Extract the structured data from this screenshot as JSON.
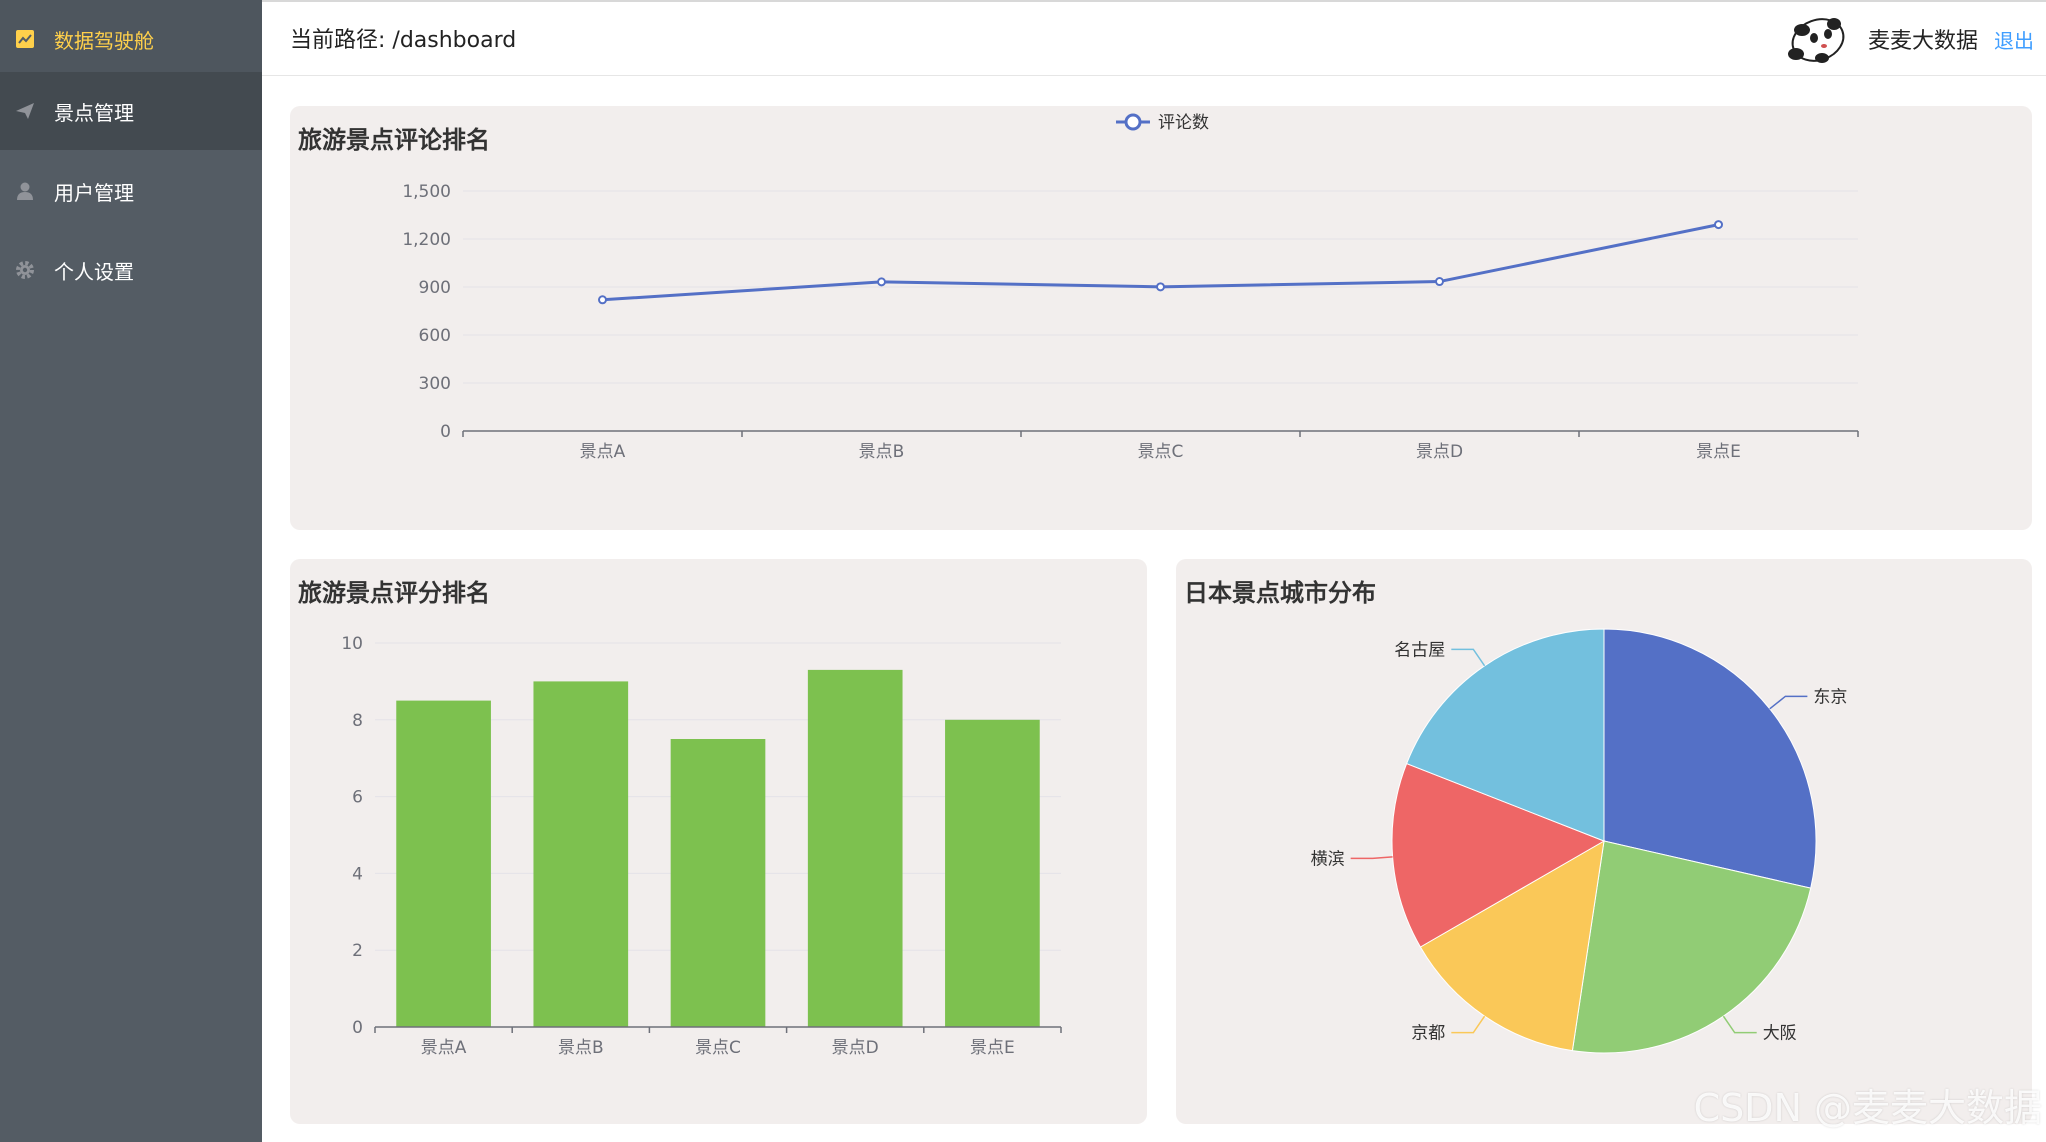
{
  "sidebar": {
    "items": [
      {
        "label": "数据驾驶舱",
        "icon": "trend-chart-icon"
      },
      {
        "label": "景点管理",
        "icon": "paper-plane-icon"
      },
      {
        "label": "用户管理",
        "icon": "user-icon"
      },
      {
        "label": "个人设置",
        "icon": "gear-icon"
      }
    ]
  },
  "header": {
    "breadcrumb": "当前路径: /dashboard",
    "user_name": "麦麦大数据",
    "logout_label": "退出"
  },
  "cards": {
    "line_title": "旅游景点评论排名",
    "bar_title": "旅游景点评分排名",
    "pie_title": "日本景点城市分布"
  },
  "watermark": "CSDN @麦麦大数据",
  "colors": {
    "sidebar_bg": "#545c64",
    "sidebar_active_text": "#ffd04b",
    "line": "#5470c6",
    "bar": "#7dc14f",
    "pie": [
      "#5470c6",
      "#91cc75",
      "#fac858",
      "#ee6666",
      "#73c0de"
    ],
    "link": "#409eff"
  },
  "chart_data": [
    {
      "type": "line",
      "title": "旅游景点评论排名",
      "legend": [
        "评论数"
      ],
      "legend_position": "top-center",
      "categories": [
        "景点A",
        "景点B",
        "景点C",
        "景点D",
        "景点E"
      ],
      "series": [
        {
          "name": "评论数",
          "values": [
            820,
            932,
            901,
            934,
            1290
          ]
        }
      ],
      "yticks": [
        "0",
        "300",
        "600",
        "900",
        "1,200",
        "1,500"
      ],
      "ylim": [
        0,
        1500
      ],
      "grid": true
    },
    {
      "type": "bar",
      "title": "旅游景点评分排名",
      "categories": [
        "景点A",
        "景点B",
        "景点C",
        "景点D",
        "景点E"
      ],
      "values": [
        8.5,
        9.0,
        7.5,
        9.3,
        8.0
      ],
      "yticks": [
        "0",
        "2",
        "4",
        "6",
        "8",
        "10"
      ],
      "ylim": [
        0,
        10
      ],
      "grid": true
    },
    {
      "type": "pie",
      "title": "日本景点城市分布",
      "labels": [
        "东京",
        "大阪",
        "京都",
        "横滨",
        "名古屋"
      ],
      "values": [
        30,
        25,
        15,
        15,
        20
      ]
    }
  ]
}
